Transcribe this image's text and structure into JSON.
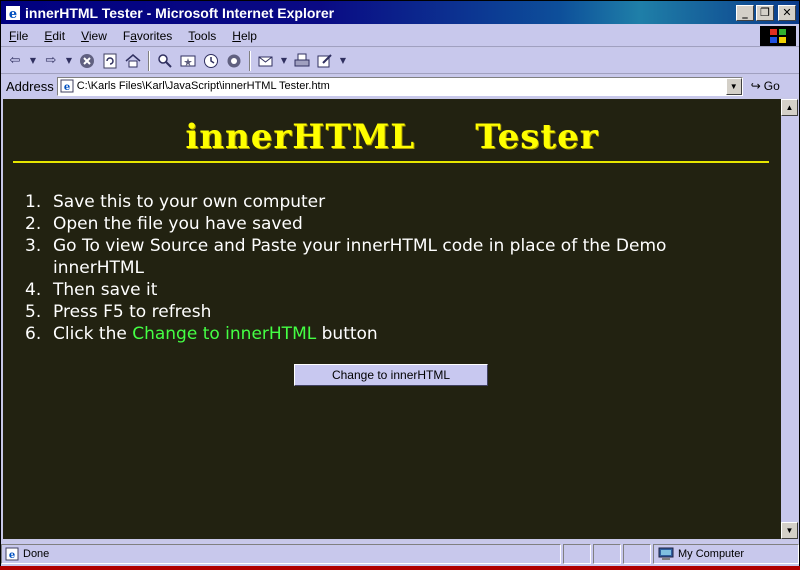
{
  "window": {
    "title": "innerHTML Tester - Microsoft Internet Explorer",
    "controls": {
      "minimize": "_",
      "maximize": "❐",
      "close": "✕"
    }
  },
  "menu": {
    "items": [
      {
        "mnemonic": "F",
        "rest": "ile"
      },
      {
        "mnemonic": "E",
        "rest": "dit"
      },
      {
        "mnemonic": "V",
        "rest": "iew"
      },
      {
        "pre": "F",
        "mnemonic": "a",
        "rest": "vorites"
      },
      {
        "mnemonic": "T",
        "rest": "ools"
      },
      {
        "mnemonic": "H",
        "rest": "elp"
      }
    ]
  },
  "toolbar": {
    "icons": [
      "back-icon",
      "forward-icon",
      "stop-icon",
      "refresh-icon",
      "home-icon",
      "search-icon",
      "favorites-icon",
      "history-icon",
      "mail-icon",
      "print-icon",
      "edit-icon"
    ]
  },
  "address": {
    "label": "Address",
    "url": "C:\\Karls Files\\Karl\\JavaScript\\innerHTML Tester.htm",
    "go_label": "Go"
  },
  "page": {
    "heading_left": "innerHTML",
    "heading_right": "Tester",
    "heading_color": "#ffff00",
    "background": "#222211",
    "highlight_color": "#44ff44",
    "steps": [
      {
        "num": "1.",
        "text": "Save this to your own computer"
      },
      {
        "num": "2.",
        "text": "Open the file you have saved"
      },
      {
        "num": "3.",
        "text": "Go To view Source and Paste your innerHTML code in place of the Demo innerHTML"
      },
      {
        "num": "4.",
        "text": "Then save it"
      },
      {
        "num": "5.",
        "text": "Press F5 to refresh"
      },
      {
        "num": "6.",
        "text_before": "Click the",
        "highlight": "Change to innerHTML",
        "text_after": "button"
      }
    ],
    "button_label": "Change to innerHTML"
  },
  "status": {
    "text": "Done",
    "zone": "My Computer"
  }
}
